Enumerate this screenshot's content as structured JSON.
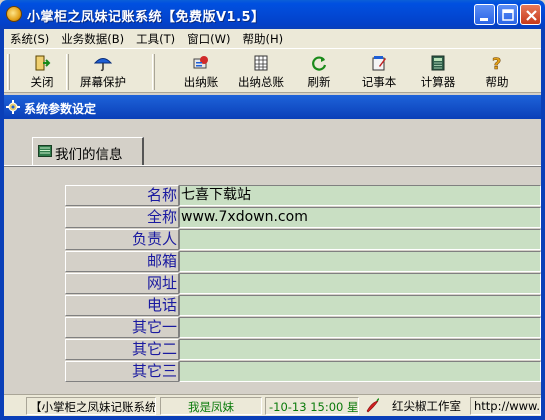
{
  "window": {
    "title": "小掌柜之凤妹记账系统【免费版V1.5】",
    "minimize_glyph": "_",
    "maximize_glyph": "□",
    "close_glyph": "×"
  },
  "menu": [
    {
      "label": "系统(S)"
    },
    {
      "label": "业务数据(B)"
    },
    {
      "label": "工具(T)"
    },
    {
      "label": "窗口(W)"
    },
    {
      "label": "帮助(H)"
    }
  ],
  "toolbar": {
    "items": [
      {
        "label": "关闭",
        "icon": "exit-door-icon"
      },
      {
        "label": "屏幕保护",
        "icon": "umbrella-icon"
      },
      {
        "label": "出纳账",
        "icon": "cash-ledger-icon"
      },
      {
        "label": "出纳总账",
        "icon": "ledger-grid-icon"
      },
      {
        "label": "刷新",
        "icon": "refresh-icon"
      },
      {
        "label": "记事本",
        "icon": "notepad-icon"
      },
      {
        "label": "计算器",
        "icon": "calculator-icon"
      },
      {
        "label": "帮助",
        "icon": "help-icon"
      }
    ]
  },
  "panel": {
    "title": "系统参数设定"
  },
  "tab": {
    "label": "我们的信息"
  },
  "form": {
    "rows": [
      {
        "label": "名称",
        "value": "七喜下载站"
      },
      {
        "label": "全称",
        "value": "www.7xdown.com"
      },
      {
        "label": "负责人",
        "value": ""
      },
      {
        "label": "邮箱",
        "value": ""
      },
      {
        "label": "网址",
        "value": ""
      },
      {
        "label": "电话",
        "value": ""
      },
      {
        "label": "其它一",
        "value": ""
      },
      {
        "label": "其它二",
        "value": ""
      },
      {
        "label": "其它三",
        "value": ""
      }
    ]
  },
  "status": {
    "app": "【小掌柜之凤妹记账系统",
    "user": "我是凤妹",
    "datetime": "-10-13 15:00 星",
    "company": "红尖椒工作室",
    "url": "http://www.h"
  },
  "colors": {
    "title_bar": "#0248d4",
    "field_bg": "#c9dfc3",
    "label_text": "#1a1aa0",
    "status_green": "#0a7a0a"
  }
}
